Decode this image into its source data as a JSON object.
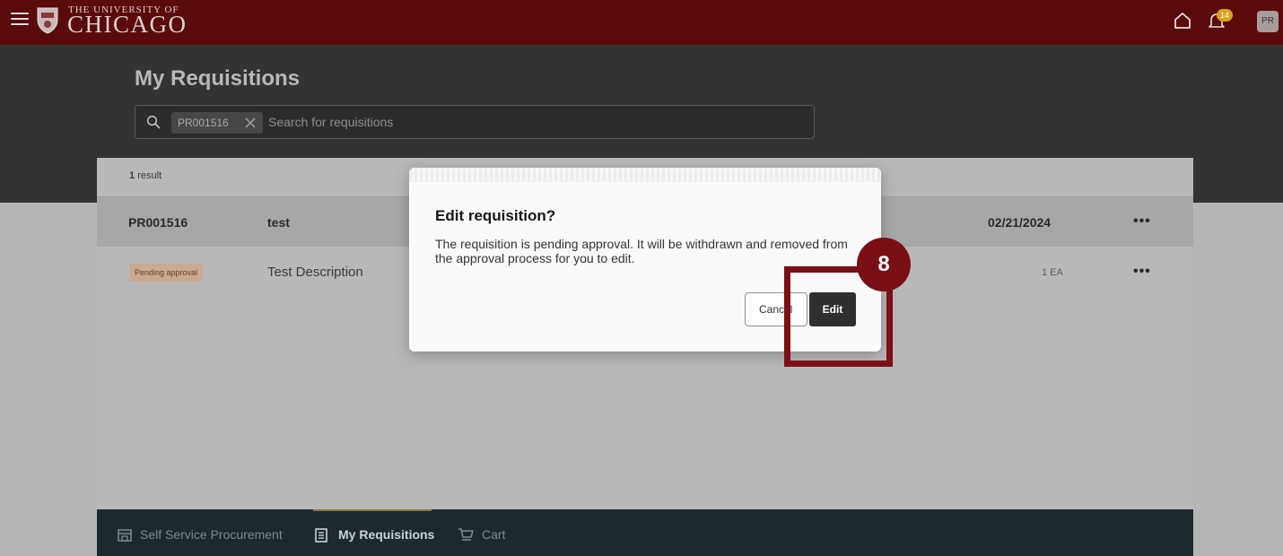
{
  "app": {
    "brand_small": "THE UNIVERSITY OF",
    "brand_big": "CHICAGO",
    "notification_count": "14",
    "avatar_initials": "PR"
  },
  "page": {
    "title": "My Requisitions"
  },
  "search": {
    "chip_value": "PR001516",
    "placeholder": "Search for requisitions"
  },
  "results": {
    "count_number": "1",
    "count_label": "result",
    "requisition": {
      "id": "PR001516",
      "name": "test",
      "date": "02/21/2024"
    },
    "line": {
      "status": "Pending approval",
      "description": "Test Description",
      "quantity": "1 EA"
    }
  },
  "dialog": {
    "title": "Edit requisition?",
    "body": "The requisition is pending approval. It will be withdrawn and removed from the approval process for you to edit.",
    "cancel_label": "Cancel",
    "edit_label": "Edit"
  },
  "bottom_nav": {
    "items": [
      {
        "label": "Self Service Procurement",
        "icon": "storefront-icon"
      },
      {
        "label": "My Requisitions",
        "icon": "clipboard-icon",
        "active": true
      },
      {
        "label": "Cart",
        "icon": "cart-icon"
      }
    ]
  },
  "annotation": {
    "step_number": "8",
    "color": "#7a0f16"
  },
  "colors": {
    "brand": "#5a0a0a",
    "status_badge_bg": "#c9aa90",
    "status_badge_text": "#6a3b20",
    "nav_background": "#1c2a2f"
  }
}
